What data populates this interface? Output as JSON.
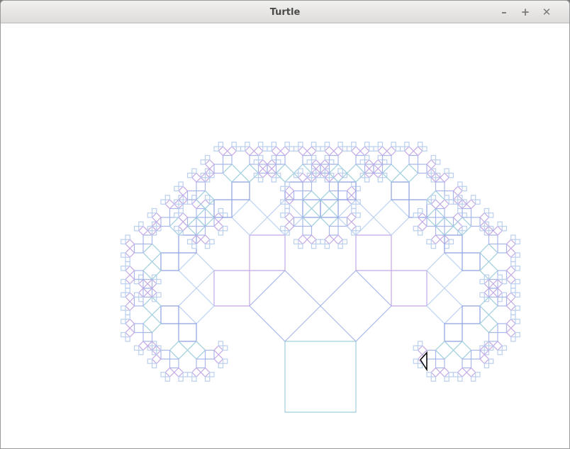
{
  "window": {
    "title": "Turtle",
    "controls": {
      "minimize": "–",
      "maximize": "+",
      "close": "✕"
    }
  },
  "canvas": {
    "background": "#ffffff",
    "drawing": "pythagoras-tree",
    "stroke_colors": [
      "#9ecfdc",
      "#a9b8e8",
      "#c3a8e6",
      "#bcd0ee",
      "#8ea0e0"
    ],
    "cursor_icon": "turtle-arrow-icon"
  }
}
